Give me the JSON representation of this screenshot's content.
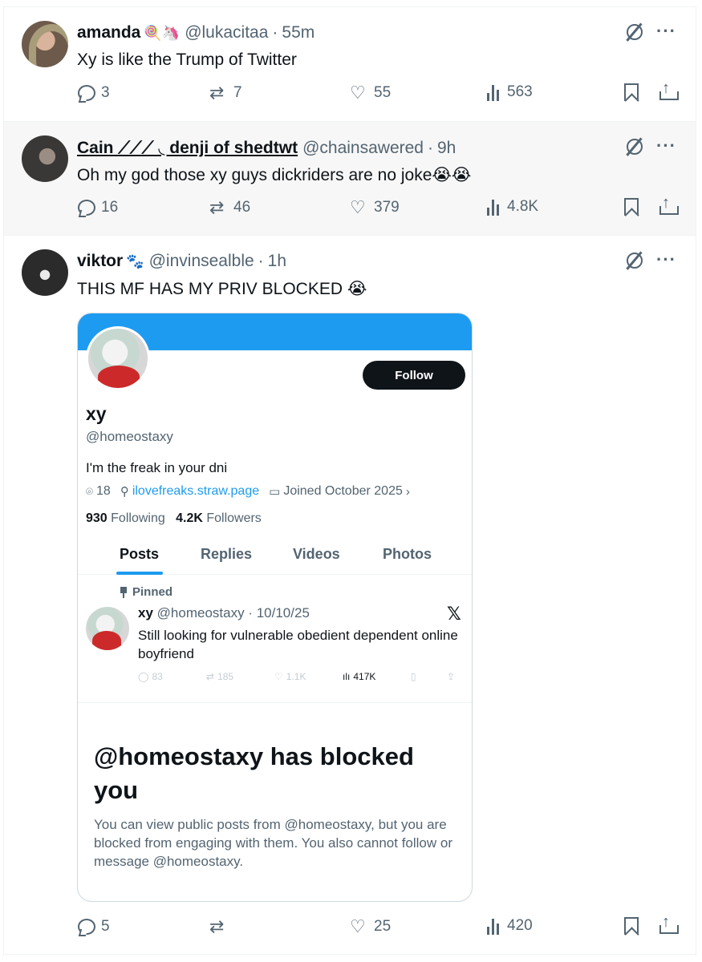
{
  "tweets": [
    {
      "name": "amanda",
      "emoji": "🍭🦄",
      "handle": "@lukacitaa",
      "dot": "·",
      "time": "55m",
      "text": "Xy is like the Trump of Twitter",
      "replies": "3",
      "retweets": "7",
      "likes": "55",
      "views": "563"
    },
    {
      "name": "Cain ⟋⟋⟋ ◟ denji of shedtwt",
      "emoji": "",
      "handle": "@chainsawered",
      "dot": "·",
      "time": "9h",
      "text": "Oh my god those xy guys dickriders are no joke😭😭",
      "replies": "16",
      "retweets": "46",
      "likes": "379",
      "views": "4.8K"
    },
    {
      "name": "viktor",
      "emoji": "🐾",
      "handle": "@invinsealble",
      "dot": "·",
      "time": "1h",
      "text": "THIS MF HAS MY PRIV BLOCKED 😭",
      "replies": "5",
      "retweets": "",
      "likes": "25",
      "views": "420"
    }
  ],
  "embedded_profile": {
    "follow_label": "Follow",
    "name": "xy",
    "handle": "@homeostaxy",
    "bio": "I'm the freak in your dni",
    "location": "18",
    "link": "ilovefreaks.straw.page",
    "joined": "Joined October 2025",
    "following_count": "930",
    "following_label": "Following",
    "followers_count": "4.2K",
    "followers_label": "Followers",
    "tabs": [
      "Posts",
      "Replies",
      "Videos",
      "Photos"
    ],
    "pinned_label": "Pinned",
    "pinned_tweet": {
      "name": "xy",
      "handle": "@homeostaxy",
      "date": "10/10/25",
      "text": "Still looking for vulnerable obedient dependent online boyfriend",
      "replies": "83",
      "retweets": "185",
      "likes": "1.1K",
      "views": "417K"
    },
    "blocked_title": "@homeostaxy has blocked you",
    "blocked_body": "You can view public posts from @homeostaxy, but you are blocked from engaging with them. You also cannot follow or message @homeostaxy."
  },
  "colors": {
    "accent": "#1d9bf0",
    "text": "#0f1419",
    "secondary": "#536471"
  }
}
